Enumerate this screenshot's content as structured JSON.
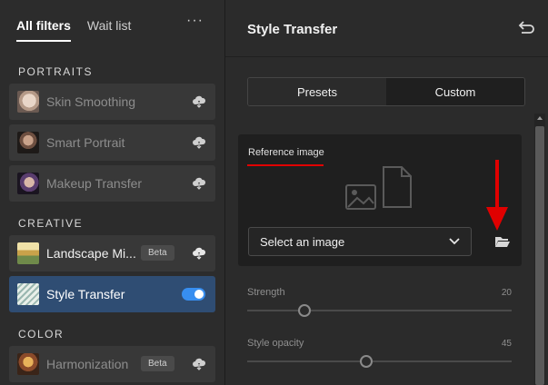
{
  "left_panel": {
    "tabs": [
      {
        "label": "All filters",
        "active": true
      },
      {
        "label": "Wait list",
        "active": false
      }
    ],
    "more_label": "···",
    "sections": [
      {
        "title": "PORTRAITS",
        "items": [
          {
            "label": "Skin Smoothing",
            "thumb": "face-portrait",
            "action": "cloud-download-icon"
          },
          {
            "label": "Smart Portrait",
            "thumb": "man-portrait",
            "action": "cloud-download-icon"
          },
          {
            "label": "Makeup Transfer",
            "thumb": "woman-portrait",
            "action": "cloud-download-icon"
          }
        ]
      },
      {
        "title": "CREATIVE",
        "items": [
          {
            "label": "Landscape Mi...",
            "thumb": "landscape",
            "badge": "Beta",
            "action": "cloud-download-icon"
          },
          {
            "label": "Style Transfer",
            "thumb": "sketch",
            "action": "toggle",
            "enabled": true,
            "selected": true
          }
        ]
      },
      {
        "title": "COLOR",
        "items": [
          {
            "label": "Harmonization",
            "thumb": "painting",
            "badge": "Beta",
            "action": "cloud-download-icon"
          }
        ]
      }
    ]
  },
  "right_panel": {
    "title": "Style Transfer",
    "undo_icon": "undo-icon",
    "segmented": {
      "options": [
        "Presets",
        "Custom"
      ],
      "selected": "Presets"
    },
    "reference": {
      "label": "Reference image",
      "select_value": "Select an image",
      "folder_icon": "folder-open-icon"
    },
    "sliders": [
      {
        "label": "Strength",
        "value": "20"
      },
      {
        "label": "Style opacity",
        "value": "45"
      }
    ]
  },
  "colors": {
    "selected_item": "#2f4d73",
    "toggle_on": "#378ef0",
    "annotation_red": "#e00000"
  }
}
